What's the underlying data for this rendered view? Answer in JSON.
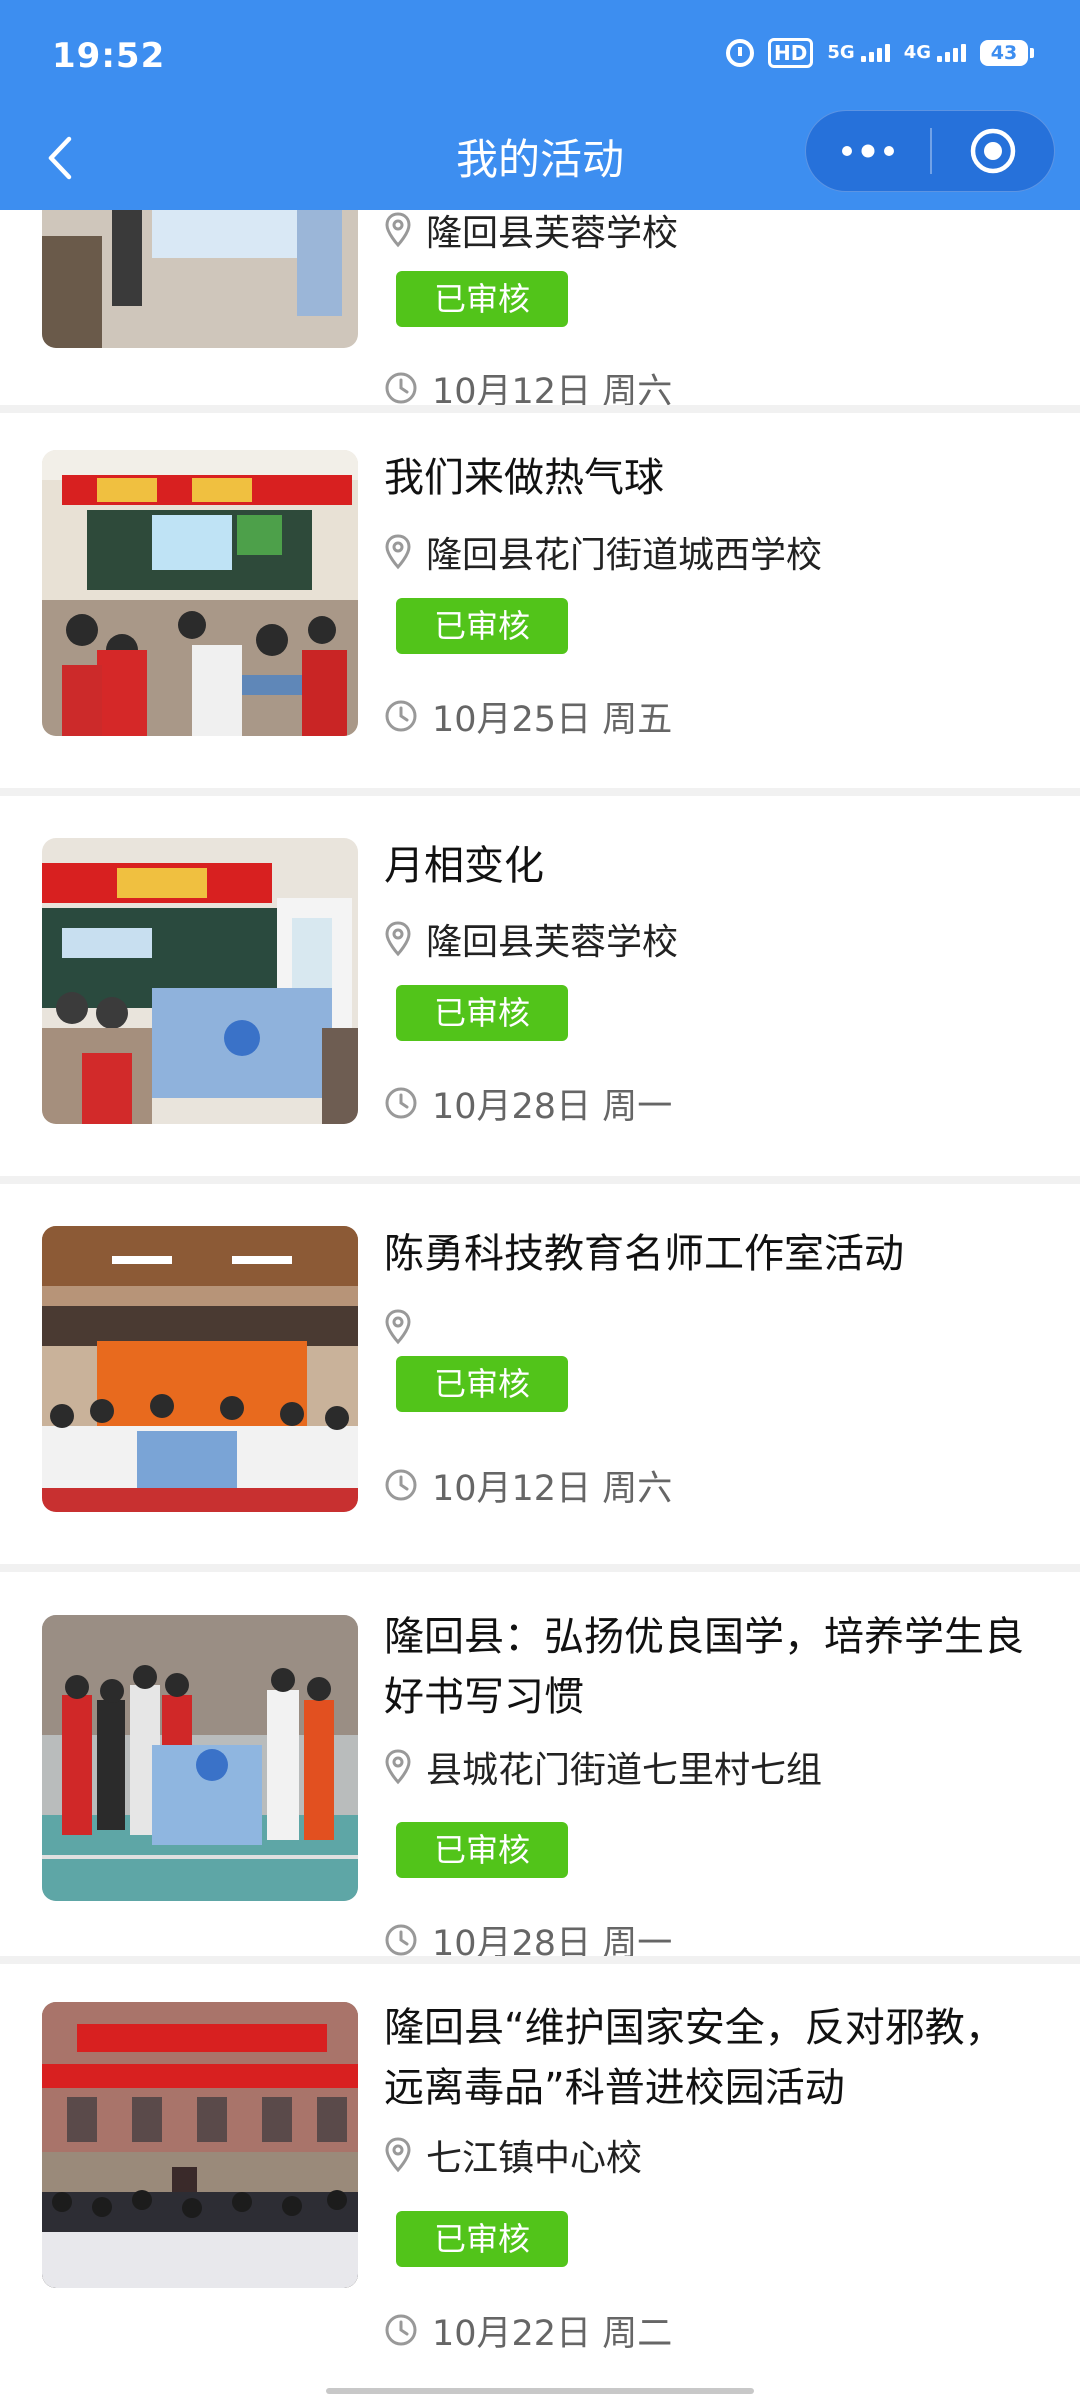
{
  "status_bar": {
    "time": "19:52",
    "hd": "HD",
    "net_5g": "5G",
    "net_4g": "4G",
    "battery": "43"
  },
  "nav": {
    "title": "我的活动",
    "more_icon": "more-dots-icon",
    "close_icon": "target-close-icon"
  },
  "colors": {
    "header_bg": "#3d8ef0",
    "badge_bg": "#52c41a"
  },
  "activities": [
    {
      "title": "",
      "location": "隆回县芙蓉学校",
      "status": "已审核",
      "date": "10月12日 周六"
    },
    {
      "title": "我们来做热气球",
      "location": "隆回县花门街道城西学校",
      "status": "已审核",
      "date": "10月25日 周五"
    },
    {
      "title": "月相变化",
      "location": "隆回县芙蓉学校",
      "status": "已审核",
      "date": "10月28日 周一"
    },
    {
      "title": "陈勇科技教育名师工作室活动",
      "location": "",
      "status": "已审核",
      "date": "10月12日 周六"
    },
    {
      "title": "隆回县：弘扬优良国学，培养学生良好书写习惯",
      "location": "县城花门街道七里村七组",
      "status": "已审核",
      "date": "10月28日 周一"
    },
    {
      "title": "隆回县“维护国家安全，反对邪教，远离毒品”科普进校园活动",
      "location": "七江镇中心校",
      "status": "已审核",
      "date": "10月22日 周二"
    }
  ]
}
